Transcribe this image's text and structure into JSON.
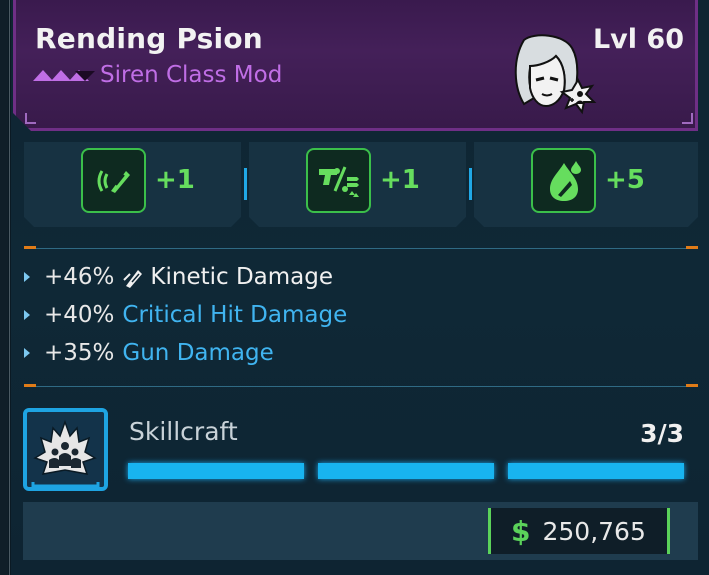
{
  "item": {
    "name": "Rending Psion",
    "level": "Lvl 60",
    "type": "Siren Class Mod",
    "rarity_icon": "purple-rarity-chevrons-icon",
    "portrait_icon": "siren-character-portrait-icon",
    "accent": "#c06ee6"
  },
  "skills": [
    {
      "icon": "kinetic-spray-icon",
      "value": "+1"
    },
    {
      "icon": "gun-ammo-up-icon",
      "value": "+1"
    },
    {
      "icon": "droplet-bullet-icon",
      "value": "+5"
    }
  ],
  "stats": [
    {
      "pct": "+46%",
      "label": "Kinetic Damage",
      "icon": "kinetic-bullet-icon",
      "color": "white"
    },
    {
      "pct": "+40%",
      "label": "Critical Hit Damage",
      "color": "blue"
    },
    {
      "pct": "+35%",
      "label": "Gun Damage",
      "color": "blue"
    }
  ],
  "skillcraft": {
    "title": "Skillcraft",
    "count": "3/3",
    "filled_segments": 3,
    "total_segments": 3,
    "icon": "skillcraft-crown-icon"
  },
  "price": {
    "currency_symbol": "$",
    "value": "250,765"
  },
  "colors": {
    "skill_green": "#66dd5e",
    "stat_blue": "#40b4f0",
    "bar_blue": "#18b4f0",
    "tick_orange": "#e07c18"
  }
}
